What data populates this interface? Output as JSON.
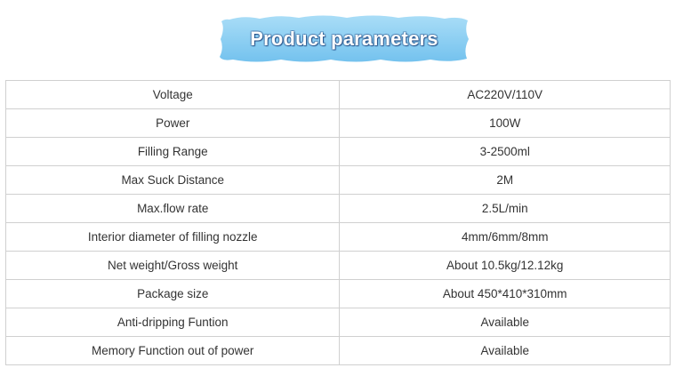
{
  "banner": {
    "title": "Product parameters"
  },
  "params": [
    {
      "label": "Voltage",
      "value": "AC220V/110V"
    },
    {
      "label": "Power",
      "value": "100W"
    },
    {
      "label": "Filling Range",
      "value": "3-2500ml"
    },
    {
      "label": "Max Suck Distance",
      "value": "2M"
    },
    {
      "label": "Max.flow rate",
      "value": "2.5L/min"
    },
    {
      "label": "Interior diameter of filling nozzle",
      "value": "4mm/6mm/8mm"
    },
    {
      "label": "Net weight/Gross weight",
      "value": "About 10.5kg/12.12kg"
    },
    {
      "label": "Package size",
      "value": "About 450*410*310mm"
    },
    {
      "label": "Anti-dripping Funtion",
      "value": "Available"
    },
    {
      "label": "Memory Function out of power",
      "value": "Available"
    }
  ]
}
